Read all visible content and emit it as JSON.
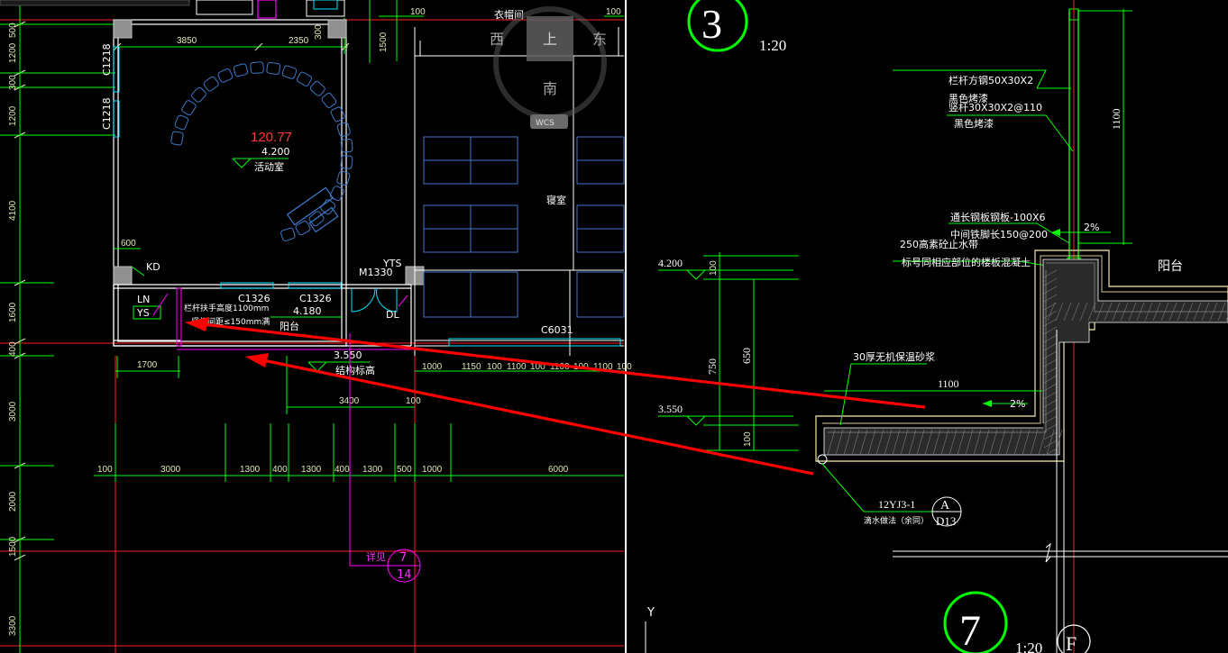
{
  "left_plan": {
    "vertical_dims": [
      "500",
      "1200",
      "300",
      "1200",
      "4100",
      "1600",
      "400",
      "3000",
      "2000",
      "1500",
      "3300"
    ],
    "top_dims": [
      "3850",
      "2350",
      "300",
      "100",
      "1500",
      "100",
      "100"
    ],
    "windows": [
      "C1218",
      "C1218",
      "C1326",
      "C1326",
      "C6031"
    ],
    "room_area": "120.77",
    "room_elev": "4.200",
    "room_name": "活动室",
    "bedroom": "寝室",
    "laundry": "衣帽间",
    "dim_600": "600",
    "kd": "KD",
    "ln": "LN",
    "ys": "YS",
    "yts": "YTS",
    "door": "M1330",
    "dl": "DL",
    "rail_note1": "栏杆扶手高度1100mm",
    "rail_note2": "竖杆间距≤150mm满",
    "balcony_elev": "4.180",
    "balcony": "阳台",
    "struct_elev": "3.550",
    "struct_label": "结构标高",
    "dim_1700": "1700",
    "dim_3400": "3400",
    "dim_100a": "100",
    "bottom_right_dims": [
      "1000",
      "1150",
      "100",
      "1100",
      "100",
      "1100",
      "100",
      "1100",
      "100"
    ],
    "lower_dims": [
      "100",
      "3000",
      "1300",
      "400",
      "1300",
      "400",
      "1300",
      "500",
      "1000",
      "6000"
    ],
    "see_detail": "详见",
    "detail_num": "7",
    "detail_sheet": "14",
    "val_300": "300"
  },
  "viewcube": {
    "west": "西",
    "top": "上",
    "east": "东",
    "south": "南",
    "wcs": "WCS"
  },
  "section": {
    "detail_no": "3",
    "scale": "1:20",
    "note_post": "栏杆方钢50X30X2",
    "note_paint1": "黑色烤漆",
    "note_bar": "竖杆30X30X2@110",
    "note_paint2": "黑色烤漆",
    "dim_1100_v": "1100",
    "note_plate": "通长钢板钢板-100X6",
    "note_anchor": "中间铁脚长150@200",
    "note_curb": "250高素砼止水带",
    "note_concrete": "标号同相应部位的楼板混凝土",
    "slope_top": "2%",
    "balcony": "阳台",
    "elev_top": "4.200",
    "elev_bot": "3.550",
    "dims_v": [
      "100",
      "750",
      "650",
      "100"
    ],
    "note_mortar": "30厚无机保温砂浆",
    "dim_1100_h": "1100",
    "slope_bot": "2%",
    "ref_std": "12YJ3-1",
    "ref_letter": "A",
    "ref_sheet": "D13",
    "note_drip": "滴水做法（余同）",
    "detail2_no": "7",
    "scale2": "1:20",
    "axis_f": "F",
    "ucs_y": "Y"
  },
  "colors": {
    "background": "#000000",
    "dim_green": "#00ff00",
    "wall_white": "#ffffff",
    "furniture_blue": "#3c78c8",
    "arrow_red": "#ff0000",
    "axis_red": "#ff2020",
    "magenta": "#ff00ff",
    "cyan": "#00e5ff"
  }
}
